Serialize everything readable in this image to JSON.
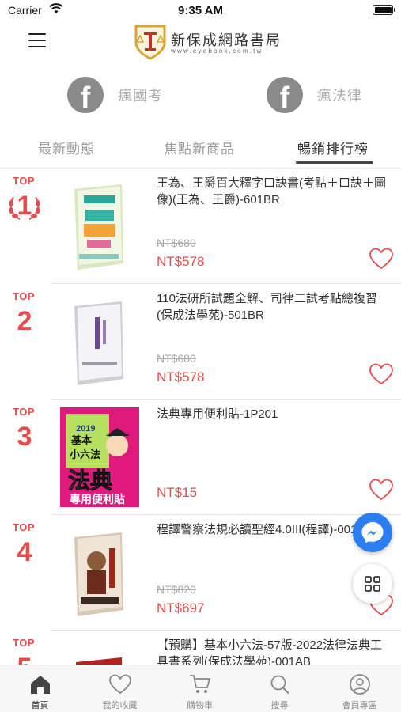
{
  "status_bar": {
    "carrier": "Carrier",
    "time": "9:35 AM"
  },
  "header": {
    "logo_title": "新保成網路書局",
    "logo_subtitle": "www.eyebook.com.tw"
  },
  "social_links": [
    {
      "label": "瘋國考",
      "icon": "facebook-icon"
    },
    {
      "label": "瘋法律",
      "icon": "facebook-icon"
    }
  ],
  "tabs": [
    {
      "label": "最新動態",
      "active": false
    },
    {
      "label": "焦點新商品",
      "active": false
    },
    {
      "label": "暢銷排行榜",
      "active": true
    }
  ],
  "ranking": {
    "top_label": "TOP",
    "items": [
      {
        "rank": "1",
        "title": "王為、王爵百大釋字口訣書(考點＋口訣＋圖像)(王為、王爵)-601BR",
        "old_price": "NT$680",
        "price": "NT$578"
      },
      {
        "rank": "2",
        "title": "110法研所試題全解、司律二試考點總複習(保成法學苑)-501BR",
        "old_price": "NT$680",
        "price": "NT$578"
      },
      {
        "rank": "3",
        "title": "法典專用便利貼-1P201",
        "old_price": "",
        "price": "NT$15",
        "cover_text": {
          "year": "2019",
          "top": "基本",
          "mid": "小六法",
          "big": "法典",
          "bottom": "專用便利貼"
        }
      },
      {
        "rank": "4",
        "title": "程譯警察法規必讀聖經4.0III(程譯)-001GA",
        "old_price": "NT$820",
        "price": "NT$697"
      },
      {
        "rank": "5",
        "title": "【預購】基本小六法-57版-2022法律法典工具書系列(保成法學苑)-001AB",
        "old_price": "",
        "price": ""
      }
    ]
  },
  "floating_buttons": [
    {
      "name": "messenger",
      "icon": "messenger-icon"
    },
    {
      "name": "grid-menu",
      "icon": "grid-icon"
    }
  ],
  "bottom_nav": [
    {
      "label": "首頁",
      "icon": "home-icon",
      "active": true
    },
    {
      "label": "我的收藏",
      "icon": "heart-icon",
      "active": false
    },
    {
      "label": "購物車",
      "icon": "cart-icon",
      "active": false
    },
    {
      "label": "搜尋",
      "icon": "search-icon",
      "active": false
    },
    {
      "label": "會員專區",
      "icon": "user-icon",
      "active": false
    }
  ],
  "colors": {
    "accent": "#e84b4b",
    "messenger": "#2b7df0",
    "icon_gray": "#8a8a8a"
  }
}
